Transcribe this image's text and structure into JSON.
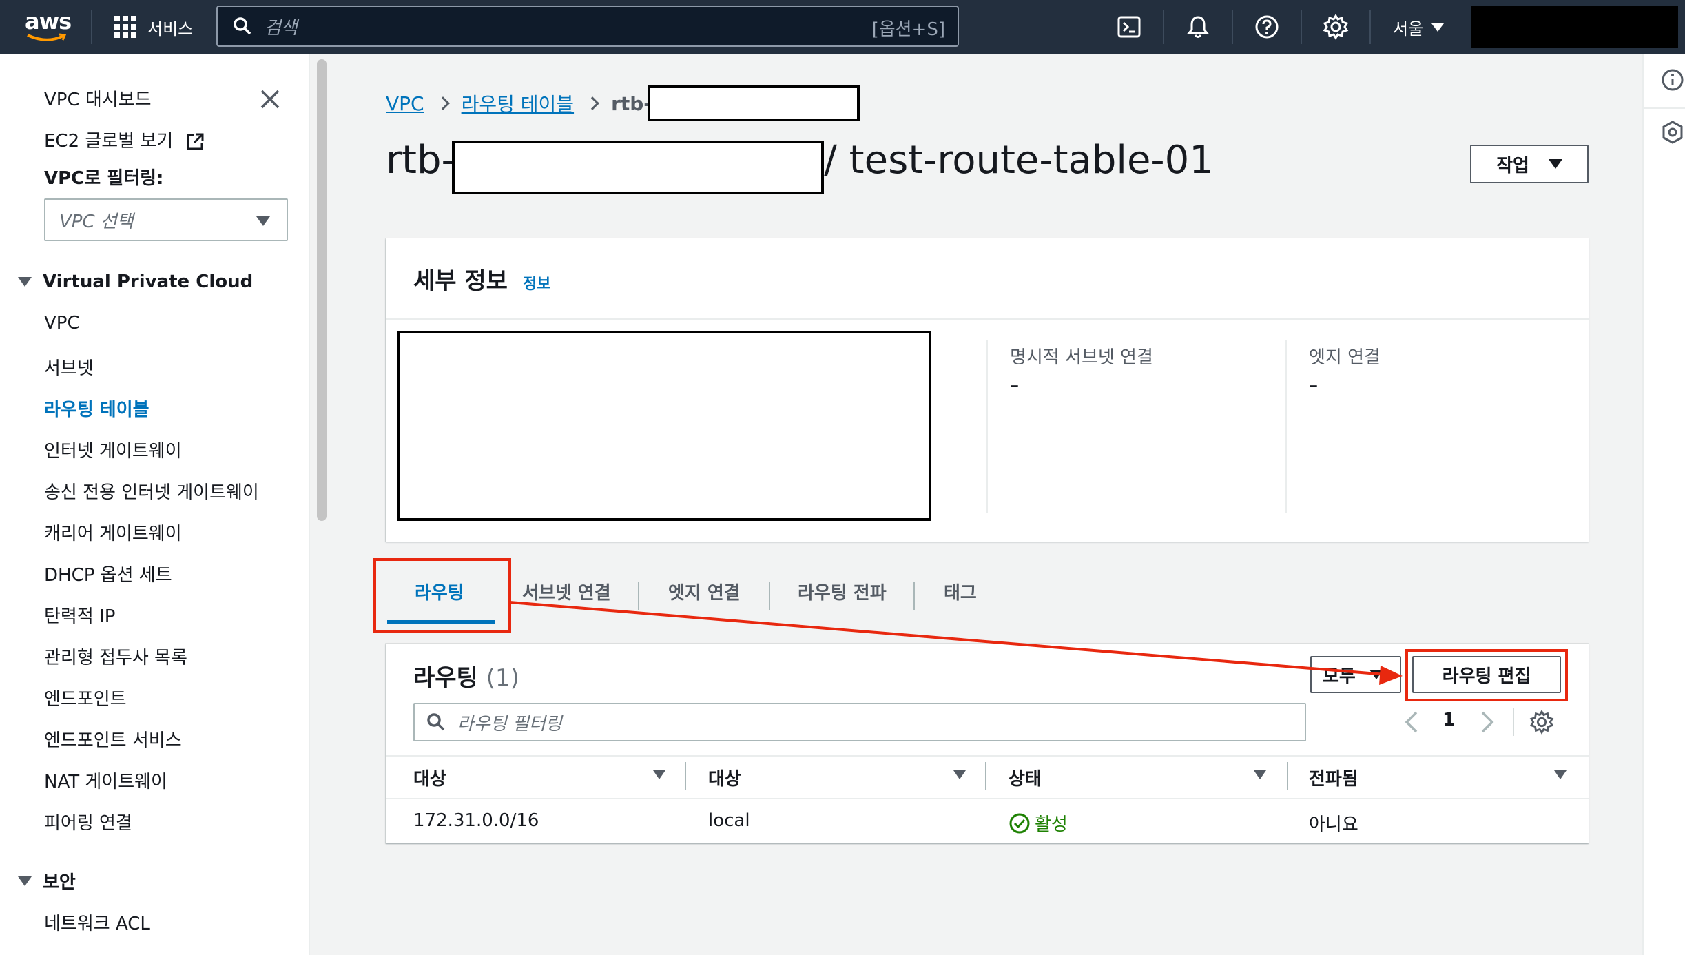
{
  "topbar": {
    "logo_text": "aws",
    "services_label": "서비스",
    "search_placeholder": "검색",
    "search_shortcut": "[옵션+S]",
    "region": "서울",
    "icons": [
      "cloudshell-icon",
      "bell-icon",
      "help-icon",
      "gear-icon"
    ]
  },
  "sidebar": {
    "top_items": [
      {
        "label": "VPC 대시보드"
      },
      {
        "label": "EC2 글로벌 보기"
      }
    ],
    "filter_label": "VPC로 필터링:",
    "vpc_select_placeholder": "VPC 선택",
    "section_vpc": "Virtual Private Cloud",
    "vpc_items": [
      {
        "label": "VPC"
      },
      {
        "label": "서브넷"
      },
      {
        "label": "라우팅 테이블",
        "active": true
      },
      {
        "label": "인터넷 게이트웨이"
      },
      {
        "label": "송신 전용 인터넷 게이트웨이"
      },
      {
        "label": "캐리어 게이트웨이"
      },
      {
        "label": "DHCP 옵션 세트"
      },
      {
        "label": "탄력적 IP"
      },
      {
        "label": "관리형 접두사 목록"
      },
      {
        "label": "엔드포인트"
      },
      {
        "label": "엔드포인트 서비스"
      },
      {
        "label": "NAT 게이트웨이"
      },
      {
        "label": "피어링 연결"
      }
    ],
    "section_security": "보안",
    "security_items": [
      {
        "label": "네트워크 ACL"
      }
    ]
  },
  "breadcrumb": {
    "root": "VPC",
    "parent": "라우팅 테이블",
    "current_prefix": "rtb-"
  },
  "page": {
    "title_prefix": "rtb-",
    "title_suffix": "/ test-route-table-01",
    "actions_label": "작업"
  },
  "details": {
    "title": "세부 정보",
    "info_label": "정보",
    "fields": [
      {
        "label": "명시적 서브넷 연결",
        "value": "–"
      },
      {
        "label": "엣지 연결",
        "value": "–"
      }
    ]
  },
  "tabs": [
    {
      "label": "라우팅",
      "active": true
    },
    {
      "label": "서브넷 연결"
    },
    {
      "label": "엣지 연결"
    },
    {
      "label": "라우팅 전파"
    },
    {
      "label": "태그"
    }
  ],
  "routes": {
    "title": "라우팅",
    "count": "(1)",
    "filter_select": "모두",
    "edit_button": "라우팅 편집",
    "filter_placeholder": "라우팅 필터링",
    "page_number": "1",
    "columns": [
      "대상",
      "대상",
      "상태",
      "전파됨"
    ],
    "rows": [
      {
        "destination": "172.31.0.0/16",
        "target": "local",
        "status": "활성",
        "propagated": "아니요"
      }
    ]
  },
  "colors": {
    "topbar_bg": "#232f3e",
    "link_blue": "#0073bb",
    "status_green": "#1d8102",
    "annotation_red": "#e8280f"
  }
}
